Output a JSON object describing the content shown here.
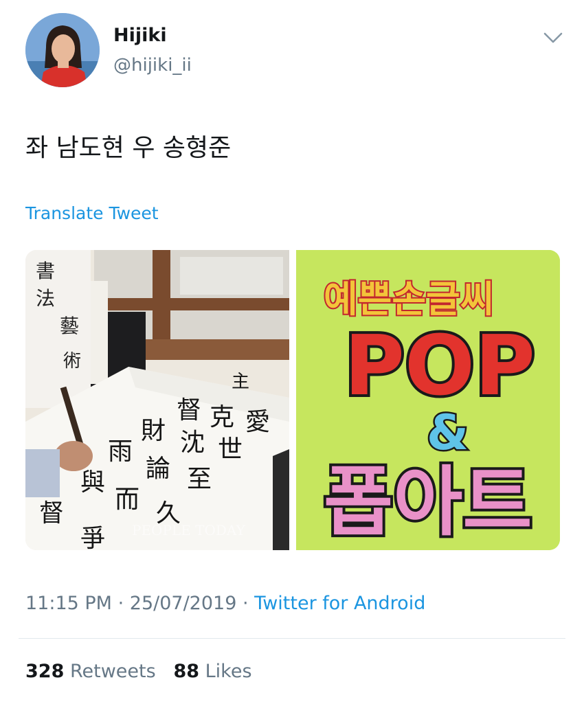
{
  "user": {
    "name": "Hijiki",
    "handle": "@hijiki_ii"
  },
  "tweet": {
    "text": "좌 남도현 우 송형준",
    "translate_label": "Translate Tweet"
  },
  "media": {
    "left_watermark": "PEOPLE TODAY",
    "right_title_top": "예쁜손글씨",
    "right_title_pop": "POP",
    "right_amp": "&",
    "right_title_bottom": "폽아트"
  },
  "meta": {
    "time": "11:15 PM",
    "date": "25/07/2019",
    "source": "Twitter for Android",
    "separator": "·"
  },
  "stats": {
    "retweets_count": "328",
    "retweets_label": "Retweets",
    "likes_count": "88",
    "likes_label": "Likes"
  },
  "colors": {
    "link": "#1b95e0",
    "secondary_text": "#657786",
    "primary_text": "#14171a"
  },
  "icons": [
    "chevron-down-icon"
  ]
}
